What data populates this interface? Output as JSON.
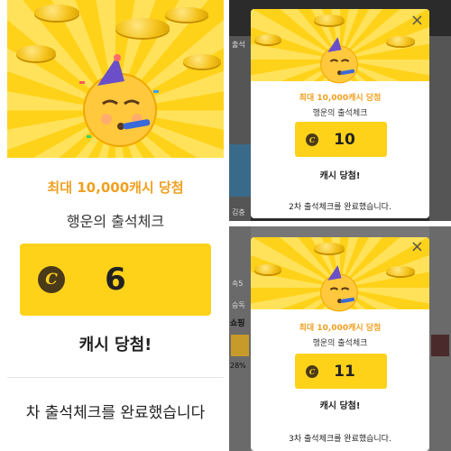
{
  "panels": [
    {
      "id": "left",
      "headline": "최대 10,000캐시 당첨",
      "subtitle": "행운의 출석체크",
      "cash_icon": "C",
      "amount": "6",
      "win_label": "캐시 당첨!",
      "completed": "차 출석체크를 완료했습니다"
    },
    {
      "id": "top-right",
      "headline": "최대 10,000캐시 당첨",
      "subtitle": "행운의 출석체크",
      "cash_icon": "C",
      "amount": "10",
      "win_label": "캐시 당첨!",
      "completed": "2차 출석체크를 완료했습니다.",
      "close": "×"
    },
    {
      "id": "bottom-right",
      "headline": "최대 10,000캐시 당첨",
      "subtitle": "행운의 출석체크",
      "cash_icon": "C",
      "amount": "11",
      "win_label": "캐시 당첨!",
      "completed": "3차 출석체크를 완료했습니다.",
      "close": "×"
    }
  ],
  "background_fragments": {
    "tr_left_top": "출석",
    "tr_left_bottom": "김충",
    "br_left_1": "속5",
    "br_left_2": "승독",
    "br_left_3": "쇼핑",
    "br_left_4": "28%"
  },
  "colors": {
    "accent": "#ffd21a",
    "headline": "#f0a020"
  }
}
